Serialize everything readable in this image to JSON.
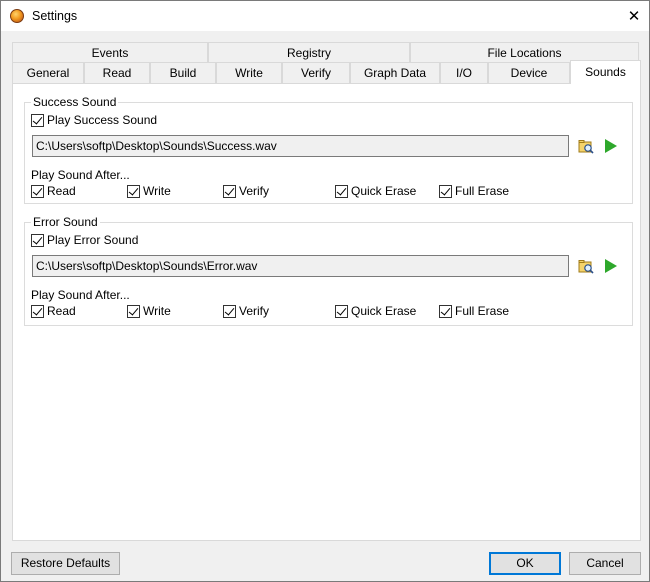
{
  "window": {
    "title": "Settings"
  },
  "tabs": {
    "row1": [
      "Events",
      "Registry",
      "File Locations"
    ],
    "row2": [
      "General",
      "Read",
      "Build",
      "Write",
      "Verify",
      "Graph Data",
      "I/O",
      "Device",
      "Sounds"
    ],
    "active": "Sounds"
  },
  "success": {
    "title": "Success Sound",
    "play_label": "Play Success Sound",
    "play_checked": true,
    "path": "C:\\Users\\softp\\Desktop\\Sounds\\Success.wav",
    "after_label": "Play Sound After...",
    "options": [
      {
        "label": "Read",
        "checked": true
      },
      {
        "label": "Write",
        "checked": true
      },
      {
        "label": "Verify",
        "checked": true
      },
      {
        "label": "Quick Erase",
        "checked": true
      },
      {
        "label": "Full Erase",
        "checked": true
      }
    ]
  },
  "error": {
    "title": "Error Sound",
    "play_label": "Play Error Sound",
    "play_checked": true,
    "path": "C:\\Users\\softp\\Desktop\\Sounds\\Error.wav",
    "after_label": "Play Sound After...",
    "options": [
      {
        "label": "Read",
        "checked": true
      },
      {
        "label": "Write",
        "checked": true
      },
      {
        "label": "Verify",
        "checked": true
      },
      {
        "label": "Quick Erase",
        "checked": true
      },
      {
        "label": "Full Erase",
        "checked": true
      }
    ]
  },
  "buttons": {
    "restore": "Restore Defaults",
    "ok": "OK",
    "cancel": "Cancel"
  },
  "icons": {
    "app": "app-orb-icon",
    "close": "close-icon",
    "browse": "folder-search-icon",
    "play": "play-icon"
  },
  "colors": {
    "play_green": "#2ea82b",
    "default_button_border": "#0078d7"
  }
}
